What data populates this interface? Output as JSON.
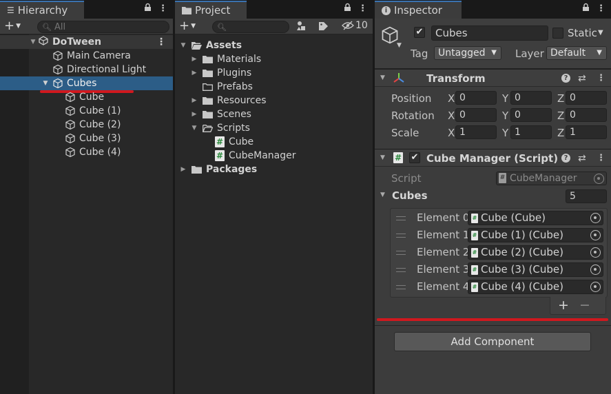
{
  "hierarchy": {
    "tab_title": "Hierarchy",
    "search_placeholder": "All",
    "scene_name": "DoTween",
    "items": [
      {
        "label": "Main Camera"
      },
      {
        "label": "Directional Light"
      },
      {
        "label": "Cubes"
      },
      {
        "label": "Cube"
      },
      {
        "label": "Cube (1)"
      },
      {
        "label": "Cube (2)"
      },
      {
        "label": "Cube (3)"
      },
      {
        "label": "Cube (4)"
      }
    ]
  },
  "project": {
    "tab_title": "Project",
    "hidden_count": "10",
    "tree": {
      "assets": "Assets",
      "materials": "Materials",
      "plugins": "Plugins",
      "prefabs": "Prefabs",
      "resources": "Resources",
      "scenes": "Scenes",
      "scripts": "Scripts",
      "script_cube": "Cube",
      "script_cubemanager": "CubeManager",
      "packages": "Packages"
    }
  },
  "inspector": {
    "tab_title": "Inspector",
    "object_name": "Cubes",
    "static_label": "Static",
    "tag_label": "Tag",
    "tag_value": "Untagged",
    "layer_label": "Layer",
    "layer_value": "Default",
    "transform": {
      "title": "Transform",
      "position_label": "Position",
      "rotation_label": "Rotation",
      "scale_label": "Scale",
      "x": "X",
      "y": "Y",
      "z": "Z",
      "position": [
        "0",
        "0",
        "0"
      ],
      "rotation": [
        "0",
        "0",
        "0"
      ],
      "scale": [
        "1",
        "1",
        "1"
      ]
    },
    "cube_manager": {
      "title": "Cube Manager (Script)",
      "script_label": "Script",
      "script_value": "CubeManager",
      "cubes_label": "Cubes",
      "cubes_count": "5",
      "elements": [
        {
          "label": "Element 0",
          "value": "Cube (Cube)"
        },
        {
          "label": "Element 1",
          "value": "Cube (1) (Cube)"
        },
        {
          "label": "Element 2",
          "value": "Cube (2) (Cube)"
        },
        {
          "label": "Element 3",
          "value": "Cube (3) (Cube)"
        },
        {
          "label": "Element 4",
          "value": "Cube (4) (Cube)"
        }
      ],
      "add_symbol": "+",
      "remove_symbol": "−"
    },
    "add_component_label": "Add Component"
  },
  "colors": {
    "selection": "#2c5d87",
    "highlight_underline": "#d0181e",
    "tab_accent": "#3a72b0"
  }
}
